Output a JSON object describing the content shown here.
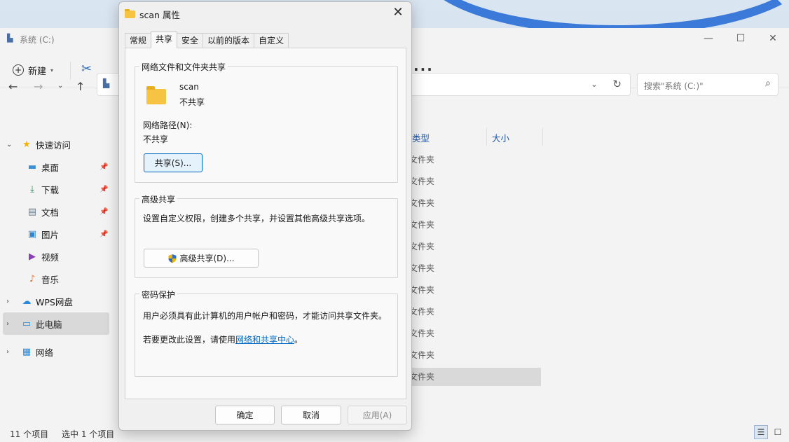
{
  "explorer": {
    "title": "系统 (C:)",
    "new_label": "新建",
    "more_label": "...",
    "search_placeholder": "搜索\"系统 (C:)\"",
    "sidebar": [
      {
        "label": "快速访问",
        "icon": "star-icon",
        "pinned": false
      },
      {
        "label": "桌面",
        "icon": "desktop-icon",
        "pinned": true
      },
      {
        "label": "下载",
        "icon": "download-icon",
        "pinned": true
      },
      {
        "label": "文档",
        "icon": "document-icon",
        "pinned": true
      },
      {
        "label": "图片",
        "icon": "picture-icon",
        "pinned": true
      },
      {
        "label": "视频",
        "icon": "video-icon",
        "pinned": false
      },
      {
        "label": "音乐",
        "icon": "music-icon",
        "pinned": false
      },
      {
        "label": "WPS网盘",
        "icon": "cloud-icon",
        "pinned": false
      },
      {
        "label": "此电脑",
        "icon": "computer-icon",
        "pinned": false
      },
      {
        "label": "网络",
        "icon": "network-icon",
        "pinned": false
      }
    ],
    "columns": {
      "type": "类型",
      "size": "大小"
    },
    "rows": [
      "文件夹",
      "文件夹",
      "文件夹",
      "文件夹",
      "文件夹",
      "文件夹",
      "文件夹",
      "文件夹",
      "文件夹",
      "文件夹",
      "文件夹"
    ],
    "status": {
      "item_count": "11 个项目",
      "selected": "选中 1 个项目"
    }
  },
  "dialog": {
    "title": "scan 属性",
    "tabs": [
      "常规",
      "共享",
      "安全",
      "以前的版本",
      "自定义"
    ],
    "active_tab": "共享",
    "network_sharing": {
      "legend": "网络文件和文件夹共享",
      "folder_name": "scan",
      "folder_state": "不共享",
      "path_label": "网络路径(N):",
      "path_value": "不共享",
      "share_button": "共享(S)..."
    },
    "advanced_sharing": {
      "legend": "高级共享",
      "description": "设置自定义权限，创建多个共享，并设置其他高级共享选项。",
      "button": "高级共享(D)..."
    },
    "password_protection": {
      "legend": "密码保护",
      "description": "用户必须具有此计算机的用户帐户和密码，才能访问共享文件夹。",
      "change_prefix": "若要更改此设置，请使用",
      "link": "网络和共享中心",
      "change_suffix": "。"
    },
    "buttons": {
      "ok": "确定",
      "cancel": "取消",
      "apply": "应用(A)"
    }
  }
}
